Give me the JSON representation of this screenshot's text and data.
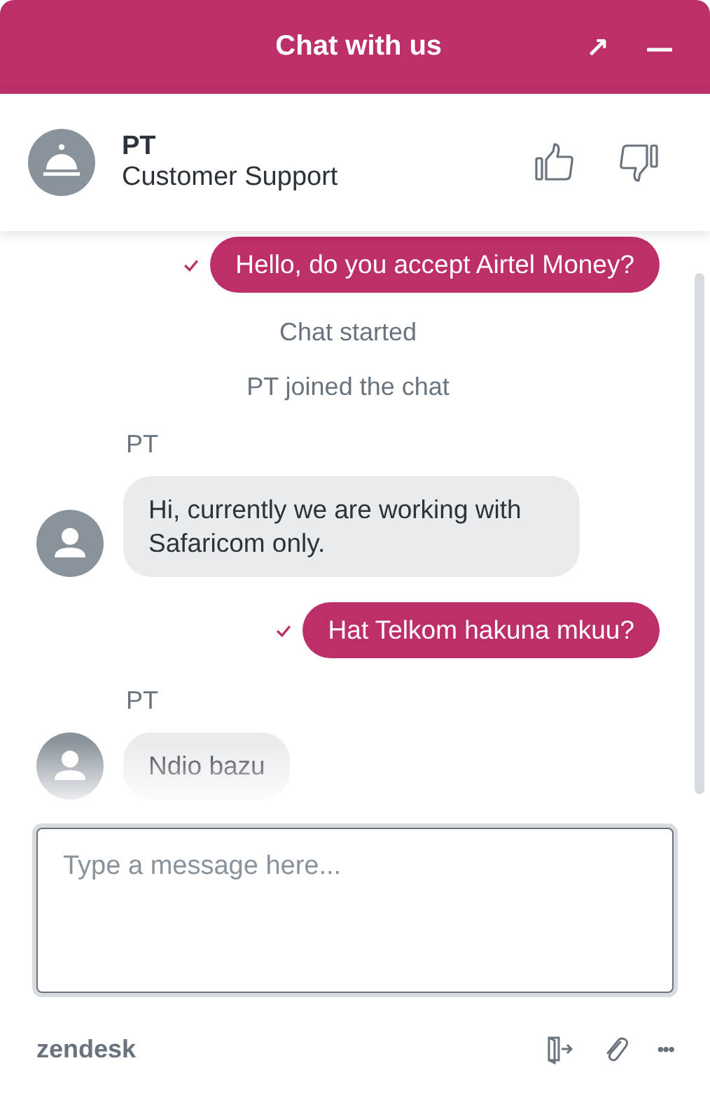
{
  "header": {
    "title": "Chat with us",
    "pop_out": "↗",
    "minimize": "—"
  },
  "agent": {
    "name": "PT",
    "role": "Customer Support"
  },
  "messages": [
    {
      "kind": "visitor",
      "text": "Hello, do you accept Airtel Money?",
      "delivered": true
    },
    {
      "kind": "system",
      "text": "Chat started"
    },
    {
      "kind": "system",
      "text": "PT joined the chat"
    },
    {
      "kind": "agent_name",
      "text": "PT"
    },
    {
      "kind": "agent",
      "text": "Hi, currently we are working with Safaricom only."
    },
    {
      "kind": "visitor",
      "text": "Hat Telkom hakuna mkuu?",
      "delivered": true
    },
    {
      "kind": "agent_name",
      "text": "PT"
    },
    {
      "kind": "agent",
      "text": "Ndio bazu"
    }
  ],
  "composer": {
    "placeholder": "Type a message here..."
  },
  "footer": {
    "brand": "zendesk",
    "more": "•••"
  }
}
